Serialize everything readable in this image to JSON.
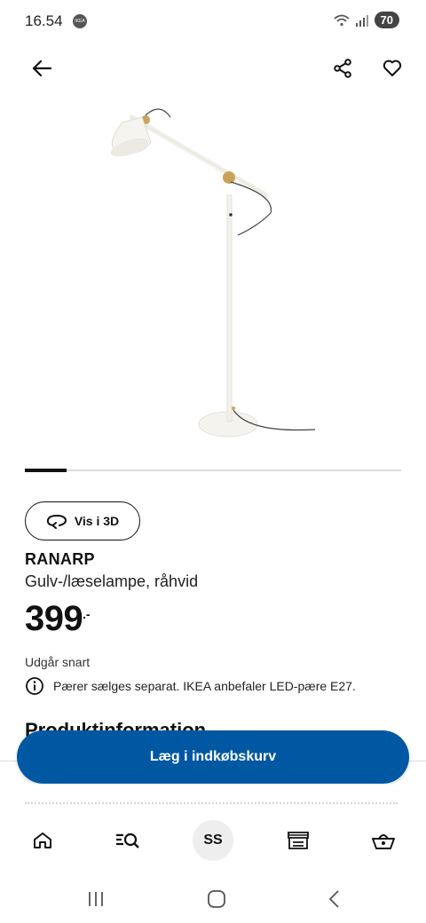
{
  "status_bar": {
    "time": "16.54",
    "app_badge": "IKEA",
    "battery": "70"
  },
  "product": {
    "name": "RANARP",
    "description": "Gulv-/læselampe, råhvid",
    "price": "399",
    "price_suffix": ".-",
    "availability": "Udgår snart",
    "info_note": "Pærer sælges separat. IKEA anbefaler LED-pære E27."
  },
  "view_3d_label": "Vis i 3D",
  "section_title": "Produktinformation",
  "cta": {
    "add_to_cart": "Læg i indkøbskurv"
  },
  "bottom_nav": {
    "avatar_initials": "SS"
  },
  "icons": [
    "back-arrow-icon",
    "share-icon",
    "heart-icon",
    "rotate-3d-icon",
    "info-icon",
    "home-icon",
    "search-list-icon",
    "store-icon",
    "basket-icon"
  ],
  "colors": {
    "accent": "#0058a3"
  }
}
